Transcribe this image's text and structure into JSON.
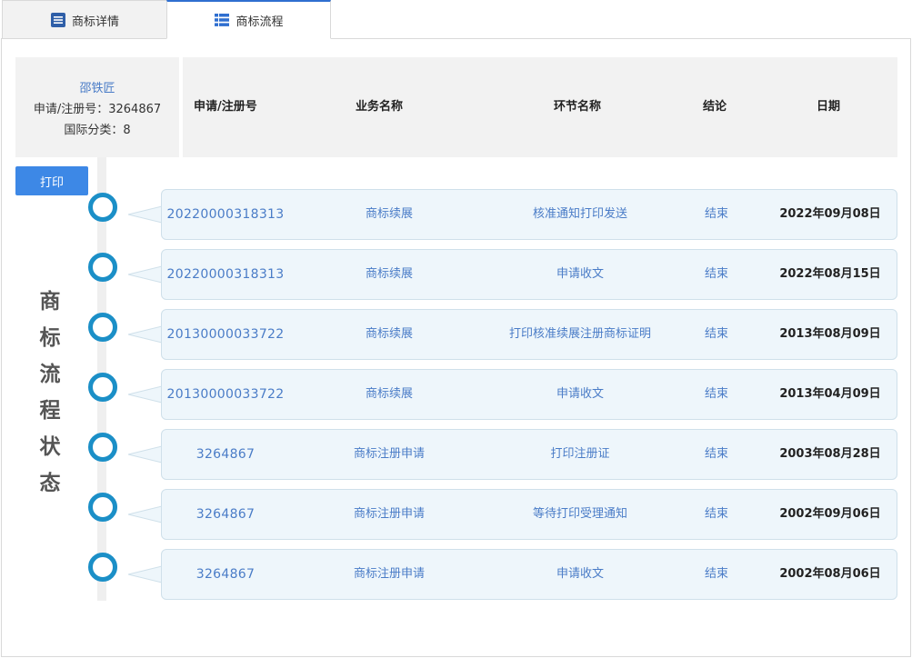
{
  "tabs": [
    {
      "label": "商标详情",
      "icon": "document-list-icon",
      "active": false
    },
    {
      "label": "商标流程",
      "icon": "table-list-icon",
      "active": true
    }
  ],
  "info": {
    "owner": "邵铁匠",
    "reg_label": "申请/注册号：3264867",
    "class_label": "国际分类：8"
  },
  "header": {
    "col_no": "申请/注册号",
    "col_biz": "业务名称",
    "col_step": "环节名称",
    "col_result": "结论",
    "col_date": "日期"
  },
  "print_label": "打印",
  "side_title": [
    "商",
    "标",
    "流",
    "程",
    "状",
    "态"
  ],
  "colors": {
    "accent": "#3d88e6",
    "link": "#4a7cc7",
    "dot": "#1b8fc7",
    "row_bg": "#eef6fb"
  },
  "rows": [
    {
      "no": "20220000318313",
      "biz": "商标续展",
      "step": "核准通知打印发送",
      "result": "结束",
      "date": "2022年09月08日"
    },
    {
      "no": "20220000318313",
      "biz": "商标续展",
      "step": "申请收文",
      "result": "结束",
      "date": "2022年08月15日"
    },
    {
      "no": "20130000033722",
      "biz": "商标续展",
      "step": "打印核准续展注册商标证明",
      "result": "结束",
      "date": "2013年08月09日"
    },
    {
      "no": "20130000033722",
      "biz": "商标续展",
      "step": "申请收文",
      "result": "结束",
      "date": "2013年04月09日"
    },
    {
      "no": "3264867",
      "biz": "商标注册申请",
      "step": "打印注册证",
      "result": "结束",
      "date": "2003年08月28日"
    },
    {
      "no": "3264867",
      "biz": "商标注册申请",
      "step": "等待打印受理通知",
      "result": "结束",
      "date": "2002年09月06日"
    },
    {
      "no": "3264867",
      "biz": "商标注册申请",
      "step": "申请收文",
      "result": "结束",
      "date": "2002年08月06日"
    }
  ]
}
